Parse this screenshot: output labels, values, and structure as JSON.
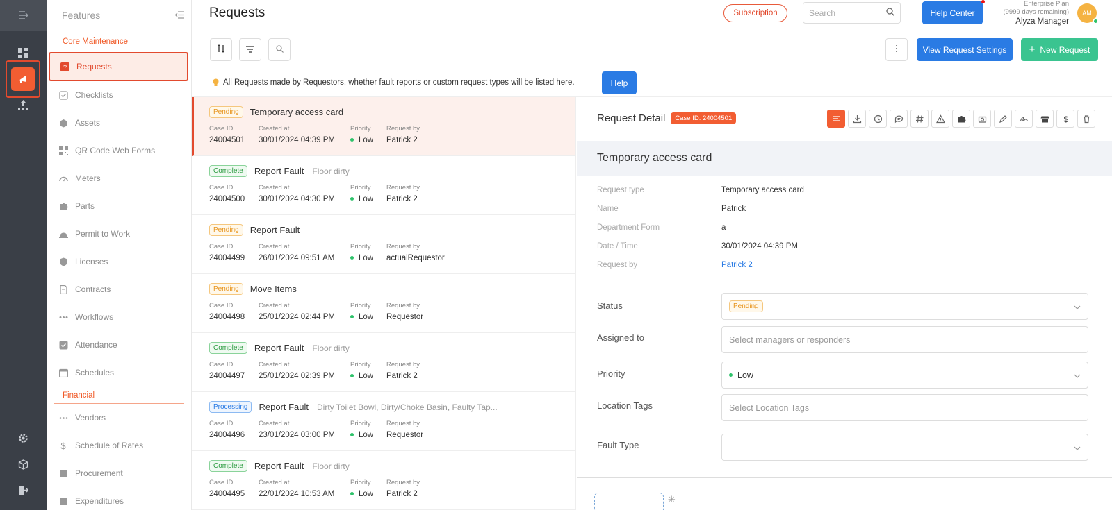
{
  "rail": {
    "icons": [
      "menu-expand-icon",
      "dashboard-icon",
      "requests-feature-icon",
      "reports-icon",
      "settings-icon",
      "cube-icon",
      "logout-icon"
    ]
  },
  "sidebar": {
    "header": "Features",
    "section_core": "Core Maintenance",
    "section_financial": "Financial",
    "items": [
      {
        "label": "Requests",
        "icon": "request-icon"
      },
      {
        "label": "Checklists",
        "icon": "checklist-icon"
      },
      {
        "label": "Assets",
        "icon": "assets-icon"
      },
      {
        "label": "QR Code Web Forms",
        "icon": "qr-code-icon"
      },
      {
        "label": "Meters",
        "icon": "meter-icon"
      },
      {
        "label": "Parts",
        "icon": "puzzle-icon"
      },
      {
        "label": "Permit to Work",
        "icon": "permit-icon"
      },
      {
        "label": "Licenses",
        "icon": "shield-icon"
      },
      {
        "label": "Contracts",
        "icon": "contract-icon"
      },
      {
        "label": "Workflows",
        "icon": "workflow-icon"
      },
      {
        "label": "Attendance",
        "icon": "attendance-icon"
      },
      {
        "label": "Schedules",
        "icon": "calendar-icon"
      }
    ],
    "financial_items": [
      {
        "label": "Vendors",
        "icon": "vendors-icon"
      },
      {
        "label": "Schedule of Rates",
        "icon": "dollar-icon"
      },
      {
        "label": "Procurement",
        "icon": "procurement-icon"
      },
      {
        "label": "Expenditures",
        "icon": "expenditures-icon"
      }
    ]
  },
  "topbar": {
    "title": "Requests",
    "subscription": "Subscription",
    "search_placeholder": "Search",
    "help_center": "Help Center",
    "plan": "Enterprise Plan",
    "plan_days": "(9999 days remaining)",
    "user": "Alyza Manager",
    "avatar_initials": "AM"
  },
  "toolbar": {
    "view_settings": "View Request Settings",
    "new_request": "New Request"
  },
  "info": {
    "text": "All Requests made by Requestors, whether fault reports or custom request types will be listed here.",
    "help": "Help"
  },
  "list_labels": {
    "case_id": "Case ID",
    "created_at": "Created at",
    "priority": "Priority",
    "request_by": "Request by"
  },
  "requests": [
    {
      "status": "Pending",
      "title": "Temporary access card",
      "extra": "",
      "case_id": "24004501",
      "created": "30/01/2024 04:39 PM",
      "priority": "Low",
      "by": "Patrick 2"
    },
    {
      "status": "Complete",
      "title": "Report Fault",
      "extra": "Floor    dirty",
      "case_id": "24004500",
      "created": "30/01/2024 04:30 PM",
      "priority": "Low",
      "by": "Patrick 2"
    },
    {
      "status": "Pending",
      "title": "Report Fault",
      "extra": "",
      "case_id": "24004499",
      "created": "26/01/2024 09:51 AM",
      "priority": "Low",
      "by": "actualRequestor"
    },
    {
      "status": "Pending",
      "title": "Move Items",
      "extra": "",
      "case_id": "24004498",
      "created": "25/01/2024 02:44 PM",
      "priority": "Low",
      "by": "Requestor"
    },
    {
      "status": "Complete",
      "title": "Report Fault",
      "extra": "Floor    dirty",
      "case_id": "24004497",
      "created": "25/01/2024 02:39 PM",
      "priority": "Low",
      "by": "Patrick 2"
    },
    {
      "status": "Processing",
      "title": "Report Fault",
      "extra": "Dirty Toilet Bowl, Dirty/Choke Basin, Faulty Tap...",
      "case_id": "24004496",
      "created": "23/01/2024 03:00 PM",
      "priority": "Low",
      "by": "Requestor"
    },
    {
      "status": "Complete",
      "title": "Report Fault",
      "extra": "Floor    dirty",
      "case_id": "24004495",
      "created": "22/01/2024 10:53 AM",
      "priority": "Low",
      "by": "Patrick 2"
    }
  ],
  "detail": {
    "header": "Request Detail",
    "case_badge": "Case ID: 24004501",
    "title": "Temporary access card",
    "icons": [
      "detail-icon",
      "download-icon",
      "clock-icon",
      "comment-icon",
      "hash-icon",
      "warning-icon",
      "puzzle-icon",
      "camera-icon",
      "edit-icon",
      "signature-icon",
      "store-icon",
      "dollar-icon",
      "trash-icon"
    ],
    "fields": [
      {
        "label": "Request type",
        "value": "Temporary access card"
      },
      {
        "label": "Name",
        "value": "Patrick"
      },
      {
        "label": "Department Form",
        "value": "a"
      },
      {
        "label": "Date / Time",
        "value": "30/01/2024 04:39 PM"
      },
      {
        "label": "Request by",
        "value": "Patrick 2"
      }
    ],
    "status_label": "Status",
    "status_value": "Pending",
    "assigned_label": "Assigned to",
    "assigned_placeholder": "Select managers or responders",
    "priority_label": "Priority",
    "priority_value": "Low",
    "location_label": "Location Tags",
    "location_placeholder": "Select Location Tags",
    "fault_label": "Fault Type"
  }
}
